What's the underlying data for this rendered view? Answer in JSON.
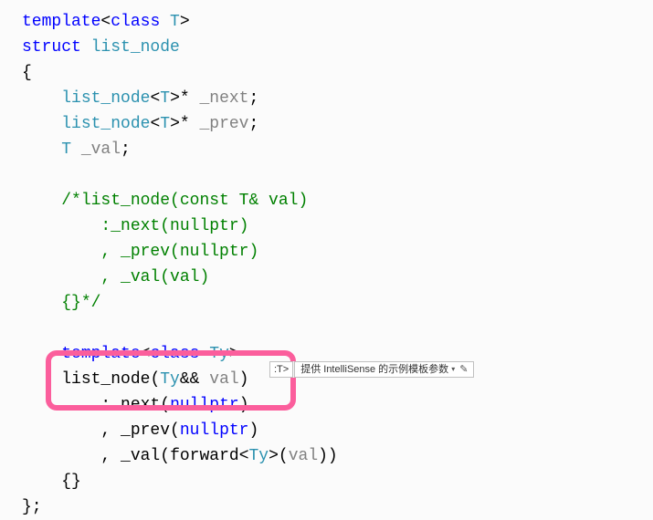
{
  "code": {
    "l1_kw1": "template",
    "l1_p1": "<",
    "l1_kw2": "class",
    "l1_name": " T",
    "l1_p2": ">",
    "l2_kw": "struct",
    "l2_name": " list_node",
    "l3": "{",
    "l4_ind": "    ",
    "l4_t": "list_node",
    "l4_p1": "<",
    "l4_tp": "T",
    "l4_p2": ">* ",
    "l4_id": "_next",
    "l4_p3": ";",
    "l5_ind": "    ",
    "l5_t": "list_node",
    "l5_p1": "<",
    "l5_tp": "T",
    "l5_p2": ">* ",
    "l5_id": "_prev",
    "l5_p3": ";",
    "l6_ind": "    ",
    "l6_tp": "T",
    "l6_id": " _val",
    "l6_p": ";",
    "l8_ind": "    ",
    "l8_c": "/*list_node(const T& val)",
    "l9_ind": "        ",
    "l9_c": ":_next(nullptr)",
    "l10_ind": "        ",
    "l10_c": ", _prev(nullptr)",
    "l11_ind": "        ",
    "l11_c": ", _val(val)",
    "l12_ind": "    ",
    "l12_c": "{}*/",
    "l14_ind": "    ",
    "l14_kw1": "template",
    "l14_p1": "<",
    "l14_kw2": "class",
    "l14_name": " Ty",
    "l14_p2": ">",
    "l15_ind": "    ",
    "l15_t": "list_node",
    "l15_p1": "(",
    "l15_tp": "Ty",
    "l15_p2": "&& ",
    "l15_id": "val",
    "l15_p3": ")",
    "l16_ind": "        ",
    "l16_p1": ":",
    "l16_id1": "_next",
    "l16_p2": "(",
    "l16_kw": "nullptr",
    "l16_p3": ")",
    "l17_ind": "        ",
    "l17_p1": ", ",
    "l17_id1": "_prev",
    "l17_p2": "(",
    "l17_kw": "nullptr",
    "l17_p3": ")",
    "l18_ind": "        ",
    "l18_p1": ", ",
    "l18_id1": "_val",
    "l18_p2": "(",
    "l18_fn": "forward",
    "l18_p3": "<",
    "l18_tp": "Ty",
    "l18_p4": ">(",
    "l18_id2": "val",
    "l18_p5": "))",
    "l19_ind": "    ",
    "l19_p": "{}",
    "l20": "};"
  },
  "intellisense": {
    "pill": ":T>",
    "text": "提供 IntelliSense 的示例模板参数",
    "tri": "▾",
    "pen": "✎"
  }
}
